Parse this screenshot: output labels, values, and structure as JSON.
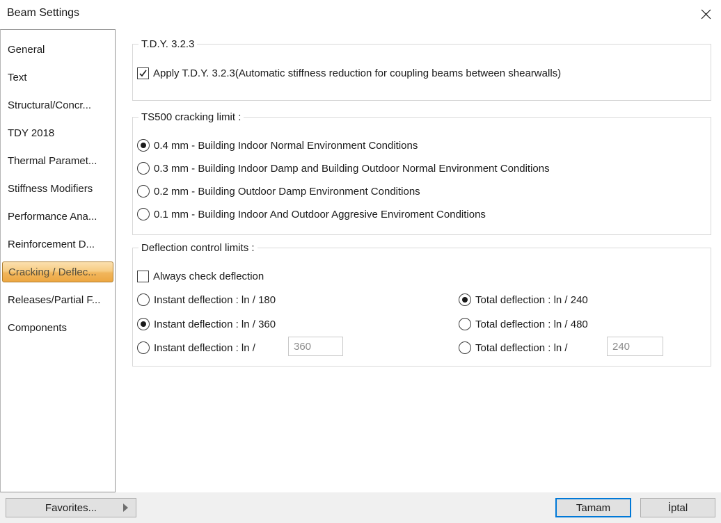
{
  "window": {
    "title": "Beam Settings",
    "close_icon": "close-x"
  },
  "sidebar": {
    "items": [
      {
        "label": "General",
        "selected": false
      },
      {
        "label": "Text",
        "selected": false
      },
      {
        "label": "Structural/Concr...",
        "selected": false
      },
      {
        "label": "TDY 2018",
        "selected": false
      },
      {
        "label": "Thermal Paramet...",
        "selected": false
      },
      {
        "label": "Stiffness Modifiers",
        "selected": false
      },
      {
        "label": "Performance Ana...",
        "selected": false
      },
      {
        "label": "Reinforcement D...",
        "selected": false
      },
      {
        "label": "Cracking / Deflec...",
        "selected": true
      },
      {
        "label": "Releases/Partial F...",
        "selected": false
      },
      {
        "label": "Components",
        "selected": false
      }
    ]
  },
  "groups": {
    "tdy": {
      "legend": "T.D.Y. 3.2.3",
      "apply_checkbox": {
        "label": "Apply T.D.Y. 3.2.3(Automatic stiffness reduction for coupling beams between shearwalls)",
        "checked": true
      }
    },
    "ts500": {
      "legend": "TS500 cracking limit :",
      "options": [
        {
          "label": "0.4 mm - Building Indoor Normal Environment Conditions",
          "selected": true
        },
        {
          "label": "0.3 mm - Building Indoor Damp and Building Outdoor Normal Environment Conditions",
          "selected": false
        },
        {
          "label": "0.2 mm - Building Outdoor Damp Environment Conditions",
          "selected": false
        },
        {
          "label": "0.1 mm - Building Indoor And Outdoor Aggresive Enviroment Conditions",
          "selected": false
        }
      ]
    },
    "deflection": {
      "legend": "Deflection control limits :",
      "always_check": {
        "label": "Always check deflection",
        "checked": false
      },
      "instant": [
        {
          "label": "Instant deflection : ln / 180",
          "selected": false
        },
        {
          "label": "Instant deflection : ln / 360",
          "selected": true
        },
        {
          "label": "Instant deflection : ln /",
          "selected": false,
          "input_value": "360"
        }
      ],
      "total": [
        {
          "label": "Total deflection  : ln / 240",
          "selected": true
        },
        {
          "label": "Total deflection : ln / 480",
          "selected": false
        },
        {
          "label": "Total deflection : ln /",
          "selected": false,
          "input_value": "240"
        }
      ]
    }
  },
  "footer": {
    "favorites_label": "Favorites...",
    "ok_label": "Tamam",
    "cancel_label": "İptal"
  },
  "colors": {
    "accent_ok_border": "#0078d7",
    "selected_item_gradient_top": "#fbe0af",
    "selected_item_gradient_bottom": "#eda742",
    "selected_item_border": "#ad7d2e",
    "bottombar_bg": "#f0f0f0",
    "button_bg": "#e1e1e1"
  }
}
